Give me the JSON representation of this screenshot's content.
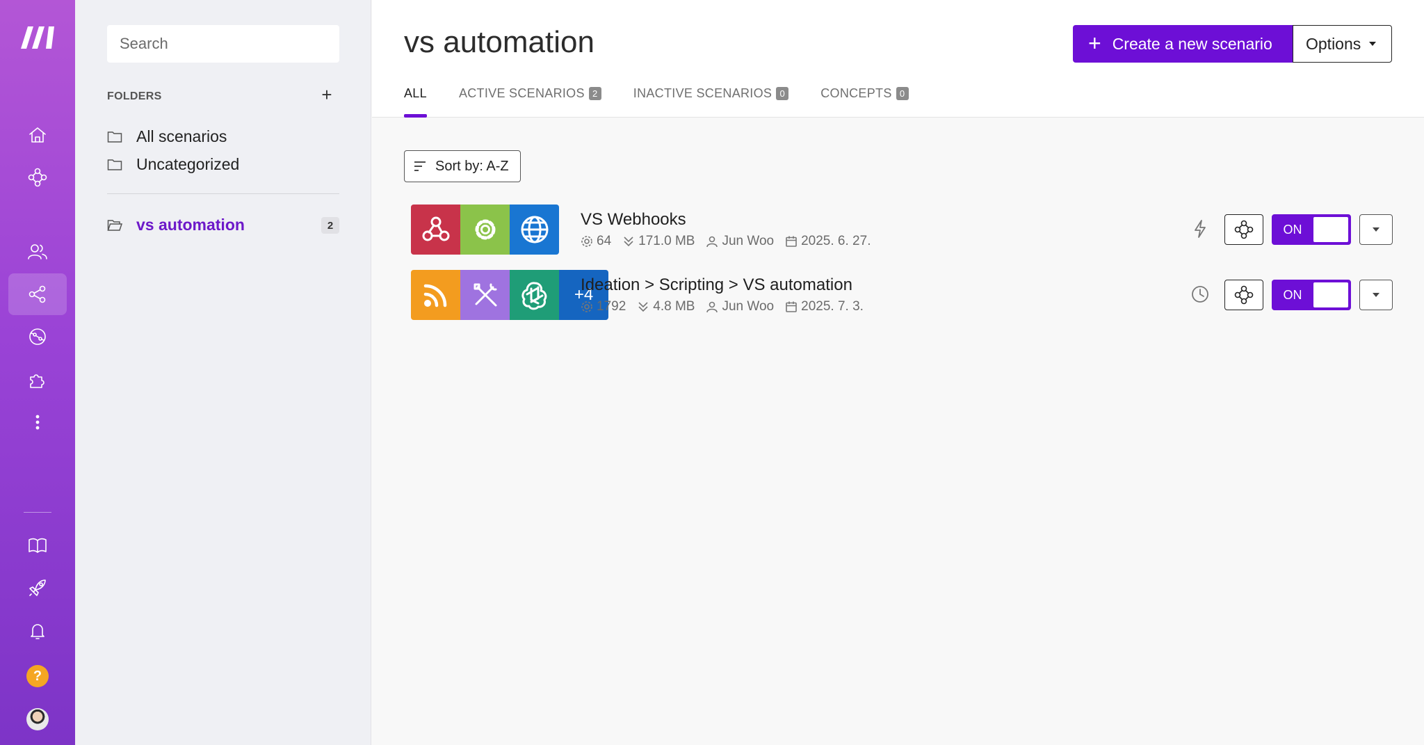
{
  "rail": {
    "colors": {
      "gradient_top": "#b356d6",
      "gradient_bottom": "#7d34c7",
      "help": "#f5a623"
    },
    "items": [
      {
        "name": "home-icon"
      },
      {
        "name": "templates-icon"
      },
      {
        "name": "team-icon"
      },
      {
        "name": "scenarios-icon",
        "active": true
      },
      {
        "name": "connections-icon"
      },
      {
        "name": "apps-icon"
      },
      {
        "name": "more-icon"
      },
      {
        "name": "docs-icon"
      },
      {
        "name": "whats-new-icon"
      },
      {
        "name": "notifications-icon"
      }
    ],
    "help_label": "?"
  },
  "folders": {
    "search_placeholder": "Search",
    "title": "FOLDERS",
    "add_label": "+",
    "items": [
      {
        "label": "All scenarios"
      },
      {
        "label": "Uncategorized"
      }
    ],
    "current": {
      "label": "vs automation",
      "count": "2"
    }
  },
  "header": {
    "title": "vs automation",
    "create_label": "Create a new scenario",
    "options_label": "Options",
    "accent": "#6d0fd6",
    "tabs": [
      {
        "label": "ALL",
        "count": "",
        "active": true
      },
      {
        "label": "ACTIVE SCENARIOS",
        "count": "2"
      },
      {
        "label": "INACTIVE SCENARIOS",
        "count": "0"
      },
      {
        "label": "CONCEPTS",
        "count": "0"
      }
    ]
  },
  "sort": {
    "label": "Sort by: A-Z"
  },
  "scenarios": [
    {
      "name": "VS Webhooks",
      "operations": "64",
      "data": "171.0 MB",
      "owner": "Jun Woo",
      "date": "2025. 6. 27.",
      "trigger": "instant",
      "status": "ON",
      "apps": [
        {
          "icon": "webhook-icon",
          "color": "#c8334a"
        },
        {
          "icon": "gear-icon",
          "color": "#8bc34a"
        },
        {
          "icon": "globe-icon",
          "color": "#1976d2"
        }
      ],
      "more_apps": ""
    },
    {
      "name": "Ideation > Scripting > VS automation",
      "operations": "1792",
      "data": "4.8 MB",
      "owner": "Jun Woo",
      "date": "2025. 7. 3.",
      "trigger": "scheduled",
      "status": "ON",
      "apps": [
        {
          "icon": "rss-icon",
          "color": "#f39c1f"
        },
        {
          "icon": "tools-icon",
          "color": "#9f73e0"
        },
        {
          "icon": "openai-icon",
          "color": "#1f9d77"
        }
      ],
      "more_apps": "+4"
    }
  ]
}
